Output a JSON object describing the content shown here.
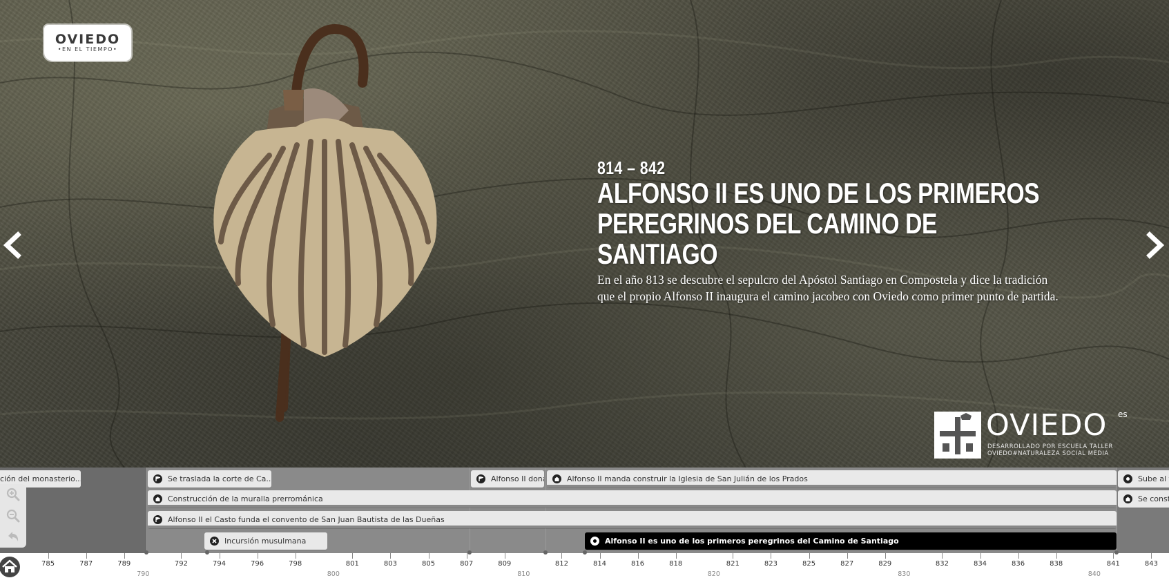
{
  "header": {
    "logo_line1": "OVIEDO",
    "logo_line2": "•EN EL TIEMPO•"
  },
  "slide": {
    "date": "814 – 842",
    "title_line1": "ALFONSO II ES UNO DE LOS PRIMEROS",
    "title_line2": "PEREGRINOS DEL CAMINO DE SANTIAGO",
    "body": "En el año 813 se descubre el sepulcro del Apóstol Santiago en Compostela y dice la tradición que el propio Alfonso II inaugura el camino jacobeo con Oviedo como primer punto de partida.",
    "illustration": "scallop-shell-and-staff"
  },
  "footer_logo": {
    "name": "OVIEDO",
    "tld": "es",
    "sub1": "DESARROLLADO POR ESCUELA TALLER",
    "sub2": "OVIEDO#NATURALEZA SOCIAL MEDIA"
  },
  "navigation": {
    "prev_icon": "chevron-left-icon",
    "next_icon": "chevron-right-icon"
  },
  "timeline": {
    "events": [
      {
        "label": "ción del monasterio...",
        "icon": "none"
      },
      {
        "label": "Se traslada la corte de Ca...",
        "icon": "flag-icon"
      },
      {
        "label": "Construcción de la muralla prerrománica",
        "icon": "building-icon"
      },
      {
        "label": "Alfonso II el Casto funda el convento de San Juan Bautista de las Dueñas",
        "icon": "flag-icon"
      },
      {
        "label": "Incursión musulmana",
        "icon": "x-icon"
      },
      {
        "label": "Alfonso II dona",
        "icon": "flag-icon"
      },
      {
        "label": "Alfonso II manda construir la Iglesia de San Julián de los Prados",
        "icon": "building-icon"
      },
      {
        "label": "Alfonso II es uno de los primeros peregrinos del Camino de Santiago",
        "icon": "pilgrim-icon",
        "active": true
      },
      {
        "label": "Sube al t",
        "icon": "pilgrim-icon"
      },
      {
        "label": "Se constr",
        "icon": "building-icon"
      }
    ],
    "axis_major": [
      "785",
      "787",
      "789",
      "792",
      "794",
      "796",
      "798",
      "801",
      "803",
      "805",
      "807",
      "809",
      "812",
      "814",
      "816",
      "818",
      "821",
      "823",
      "825",
      "827",
      "829",
      "832",
      "834",
      "836",
      "838",
      "841",
      "843"
    ],
    "axis_decades": [
      "790",
      "800",
      "810",
      "820",
      "830",
      "840"
    ],
    "zoom_in_icon": "zoom-in-icon",
    "zoom_out_icon": "zoom-out-icon",
    "back_icon": "back-arrow-icon",
    "home_icon": "home-icon"
  }
}
